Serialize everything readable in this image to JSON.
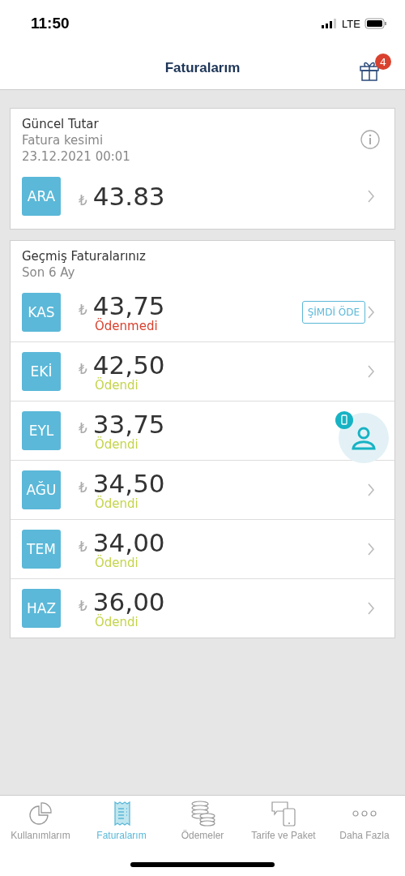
{
  "status_bar": {
    "time": "11:50",
    "network": "LTE"
  },
  "header": {
    "title": "Faturalarım",
    "badge": "4"
  },
  "current": {
    "title": "Güncel Tutar",
    "subtitle": "Fatura kesimi",
    "date": "23.12.2021 00:01",
    "month": "ARA",
    "currency": "₺",
    "amount": "43.83"
  },
  "history": {
    "title": "Geçmiş Faturalarınız",
    "subtitle": "Son 6 Ay",
    "bills": [
      {
        "month": "KAS",
        "currency": "₺",
        "amount": "43,75",
        "status": "Ödenmedi",
        "paid": false,
        "action": "ŞİMDİ ÖDE"
      },
      {
        "month": "EKİ",
        "currency": "₺",
        "amount": "42,50",
        "status": "Ödendi",
        "paid": true
      },
      {
        "month": "EYL",
        "currency": "₺",
        "amount": "33,75",
        "status": "Ödendi",
        "paid": true,
        "chevron": false
      },
      {
        "month": "AĞU",
        "currency": "₺",
        "amount": "34,50",
        "status": "Ödendi",
        "paid": true
      },
      {
        "month": "TEM",
        "currency": "₺",
        "amount": "34,00",
        "status": "Ödendi",
        "paid": true
      },
      {
        "month": "HAZ",
        "currency": "₺",
        "amount": "36,00",
        "status": "Ödendi",
        "paid": true
      }
    ]
  },
  "tabs": [
    {
      "label": "Kullanımlarım",
      "kind": "usage",
      "selected": false
    },
    {
      "label": "Faturalarım",
      "kind": "bills",
      "selected": true
    },
    {
      "label": "Ödemeler",
      "kind": "payments",
      "selected": false
    },
    {
      "label": "Tarife ve Paket",
      "kind": "plans",
      "selected": false
    },
    {
      "label": "Daha Fazla",
      "kind": "more",
      "selected": false
    }
  ]
}
